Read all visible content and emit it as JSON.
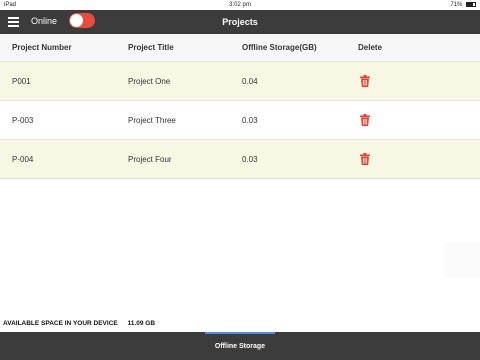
{
  "status_bar": {
    "carrier": "iPad",
    "time": "3:02 pm",
    "battery": "71%"
  },
  "navbar": {
    "online_label": "Online",
    "online_toggle_on": true,
    "title": "Projects"
  },
  "table": {
    "headers": [
      "Project Number",
      "Project Title",
      "Offline Storage(GB)",
      "Delete"
    ],
    "rows": [
      {
        "number": "P001",
        "title": "Project One",
        "storage": "0.04"
      },
      {
        "number": "P-003",
        "title": "Project Three",
        "storage": "0.03"
      },
      {
        "number": "P-004",
        "title": "Project Four",
        "storage": "0.03"
      }
    ],
    "delete_icon": "trash-icon"
  },
  "footer": {
    "space_label": "AVAILABLE SPACE IN YOUR DEVICE",
    "space_value": "11.09 GB"
  },
  "bottom_bar": {
    "tab_label": "Offline Storage"
  },
  "colors": {
    "navbar": "#3c3c3c",
    "toggle": "#e94b3c",
    "delete": "#e8412f",
    "row_highlight": "#f6f8e4",
    "tab_indicator": "#4a90e2"
  }
}
